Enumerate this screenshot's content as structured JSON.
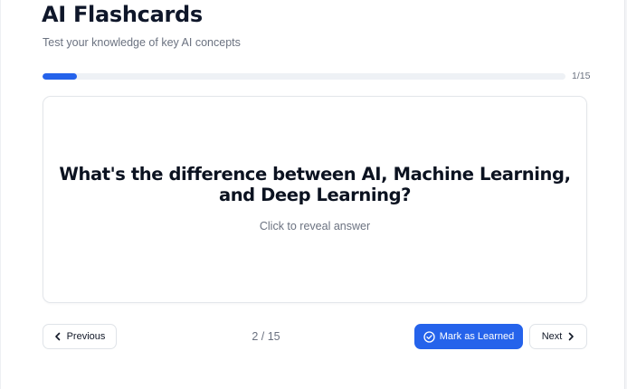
{
  "header": {
    "title": "AI Flashcards",
    "subtitle": "Test your knowledge of key AI concepts"
  },
  "progress": {
    "label": "1/15",
    "fraction": 0.065
  },
  "card": {
    "question": "What's the difference between AI, Machine Learning, and Deep Learning?",
    "hint": "Click to reveal answer"
  },
  "navigation": {
    "previous_label": "Previous",
    "page_indicator": "2 / 15",
    "mark_learned_label": "Mark as Learned",
    "next_label": "Next"
  },
  "colors": {
    "accent": "#2563eb",
    "title_text": "#0f172a",
    "muted_text": "#6b7280"
  },
  "icons": {
    "previous": "chevron-left-icon",
    "mark_learned": "check-circle-icon",
    "next": "chevron-right-icon"
  }
}
